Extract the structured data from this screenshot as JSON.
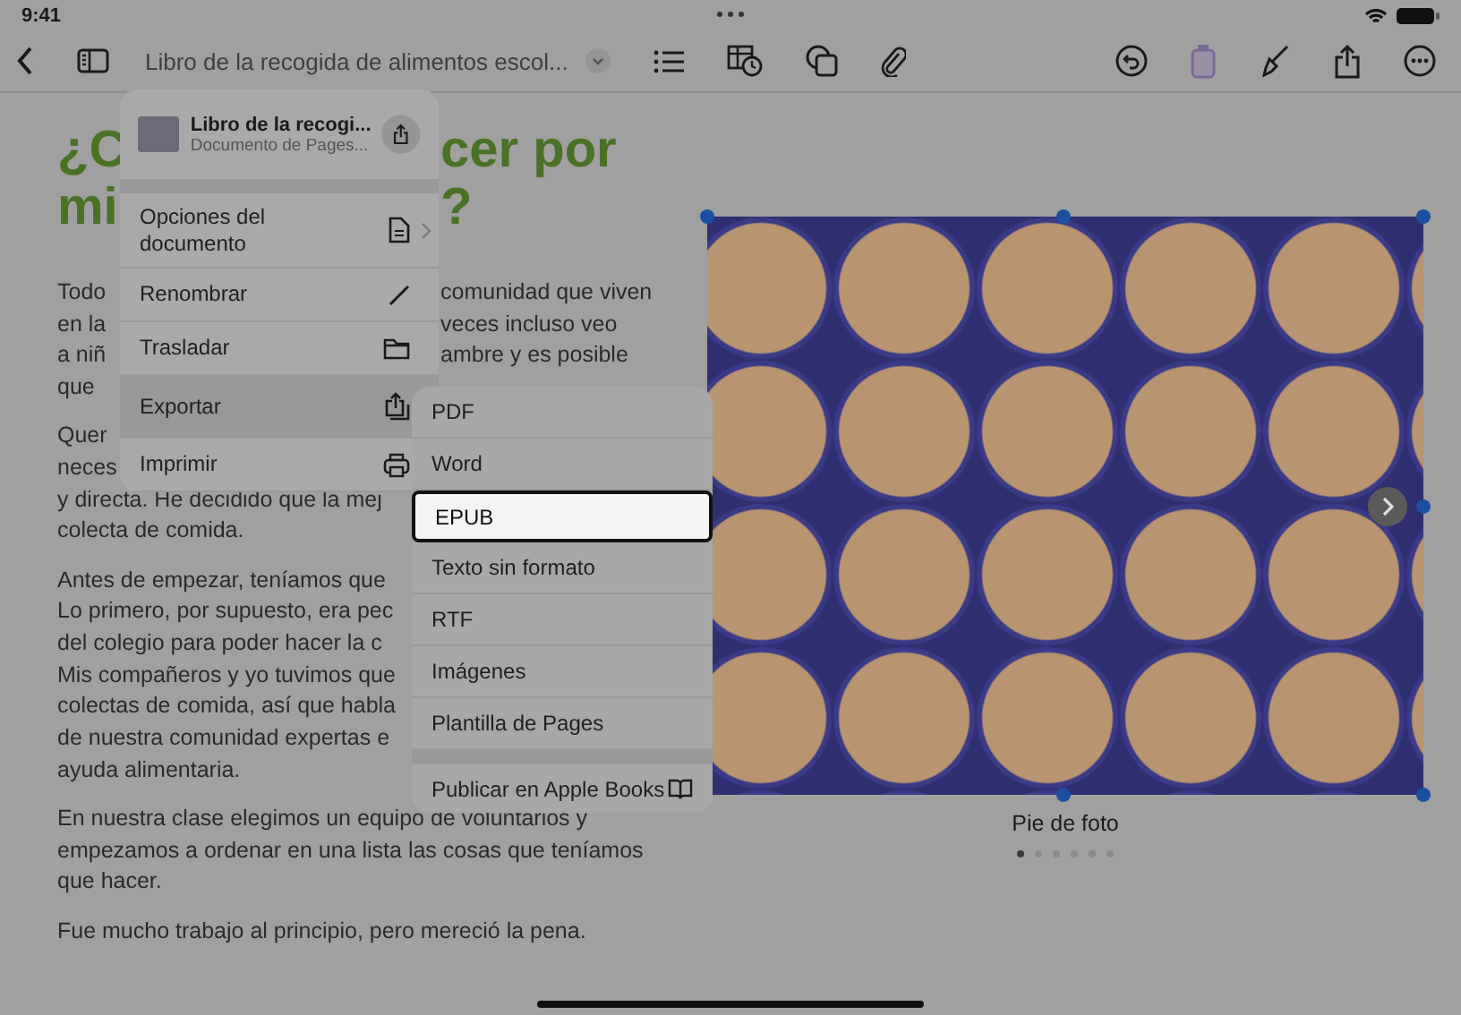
{
  "status_bar": {
    "time": "9:41"
  },
  "toolbar": {
    "document_title": "Libro de la recogida de alimentos escol..."
  },
  "document": {
    "title_lines": [
      {
        "left": "¿C",
        "right": "cer por"
      },
      {
        "left": "mi",
        "right": "?"
      }
    ],
    "paragraphs": [
      {
        "lines": [
          {
            "left": "Todo",
            "right": "comunidad que viven"
          },
          {
            "left": "en la",
            "right": "veces incluso veo"
          },
          {
            "left": "a niñ",
            "right": "ambre y es posible"
          },
          {
            "left": "que"
          }
        ]
      },
      {
        "lines": [
          {
            "left": "Quer"
          },
          {
            "left": "neces"
          },
          {
            "left": "y directa. He decidido que la mej"
          },
          {
            "left": "colecta de comida."
          }
        ]
      },
      {
        "lines": [
          {
            "left": "Antes de empezar, teníamos que"
          },
          {
            "left": "Lo primero, por supuesto, era pec"
          },
          {
            "left": "del colegio para poder hacer la c"
          },
          {
            "left": "Mis compañeros y yo tuvimos que"
          },
          {
            "left": "colectas de comida, así que habla"
          },
          {
            "left": "de nuestra comunidad expertas e"
          },
          {
            "left": "ayuda alimentaria."
          }
        ]
      },
      {
        "lines": [
          {
            "left": "En nuestra clase elegimos un equipo de voluntarios y"
          },
          {
            "left": "empezamos a ordenar en una lista las cosas que teníamos"
          },
          {
            "left": "que hacer."
          }
        ]
      },
      {
        "lines": [
          {
            "left": "Fue mucho trabajo al principio, pero mereció la pena."
          }
        ]
      }
    ]
  },
  "image": {
    "caption": "Pie de foto",
    "page_dots": [
      {
        "selected": true
      },
      {
        "selected": false
      },
      {
        "selected": false
      },
      {
        "selected": false
      },
      {
        "selected": false
      },
      {
        "selected": false
      }
    ]
  },
  "file_menu": {
    "header": {
      "title": "Libro de la recogi...",
      "subtitle": "Documento de Pages..."
    },
    "items": [
      {
        "label": "Opciones del documento",
        "selected": false,
        "chevron": true
      },
      {
        "label": "Renombrar",
        "selected": false,
        "chevron": false
      },
      {
        "label": "Trasladar",
        "selected": false,
        "chevron": false
      },
      {
        "label": "Exportar",
        "selected": true,
        "chevron": false
      },
      {
        "label": "Imprimir",
        "selected": false,
        "chevron": false
      }
    ]
  },
  "export_menu": {
    "items": [
      {
        "label": "PDF",
        "selected": false
      },
      {
        "label": "Word",
        "selected": false
      },
      {
        "label": "EPUB",
        "selected": true
      },
      {
        "label": "Texto sin formato",
        "selected": false
      },
      {
        "label": "RTF",
        "selected": false
      },
      {
        "label": "Imágenes",
        "selected": false
      },
      {
        "label": "Plantilla de Pages",
        "selected": false
      }
    ],
    "footer_item": {
      "label": "Publicar en Apple Books",
      "selected": false
    }
  }
}
